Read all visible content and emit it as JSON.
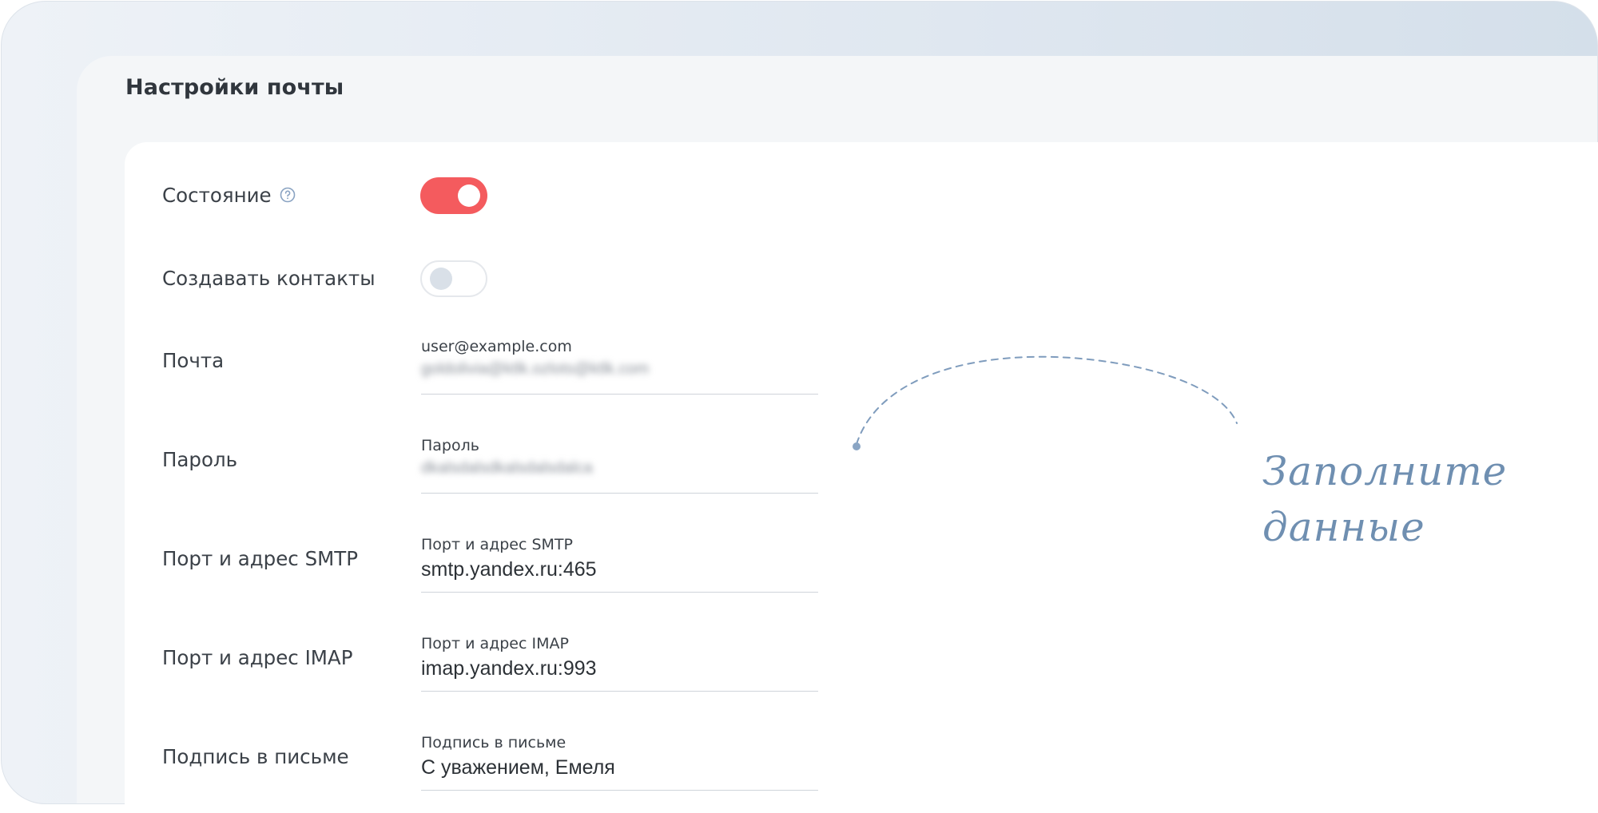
{
  "page": {
    "title": "Настройки почты"
  },
  "settings": {
    "status": {
      "label": "Состояние",
      "enabled": true
    },
    "create_contacts": {
      "label": "Создавать контакты",
      "enabled": false
    },
    "email": {
      "label": "Почта",
      "caption": "user@example.com",
      "value": "goldolivia@ktlk.ozlots@ktlk.com"
    },
    "password": {
      "label": "Пароль",
      "caption": "Пароль",
      "value": "dkalsdalsdkalsdalsdalca"
    },
    "smtp": {
      "label": "Порт и адрес SMTP",
      "caption": "Порт и адрес SMTP",
      "value": "smtp.yandex.ru:465"
    },
    "imap": {
      "label": "Порт и адрес IMAP",
      "caption": "Порт и адрес IMAP",
      "value": "imap.yandex.ru:993"
    },
    "signature": {
      "label": "Подпись в письме",
      "caption": "Подпись в письме",
      "value": "С уважением, Емеля"
    }
  },
  "annotation": {
    "line1": "Заполните",
    "line2": "данные"
  },
  "colors": {
    "toggle_on": "#f45b5e",
    "accent_annotation": "#6f8fb1"
  },
  "icons": {
    "help": "question-circle-icon"
  }
}
